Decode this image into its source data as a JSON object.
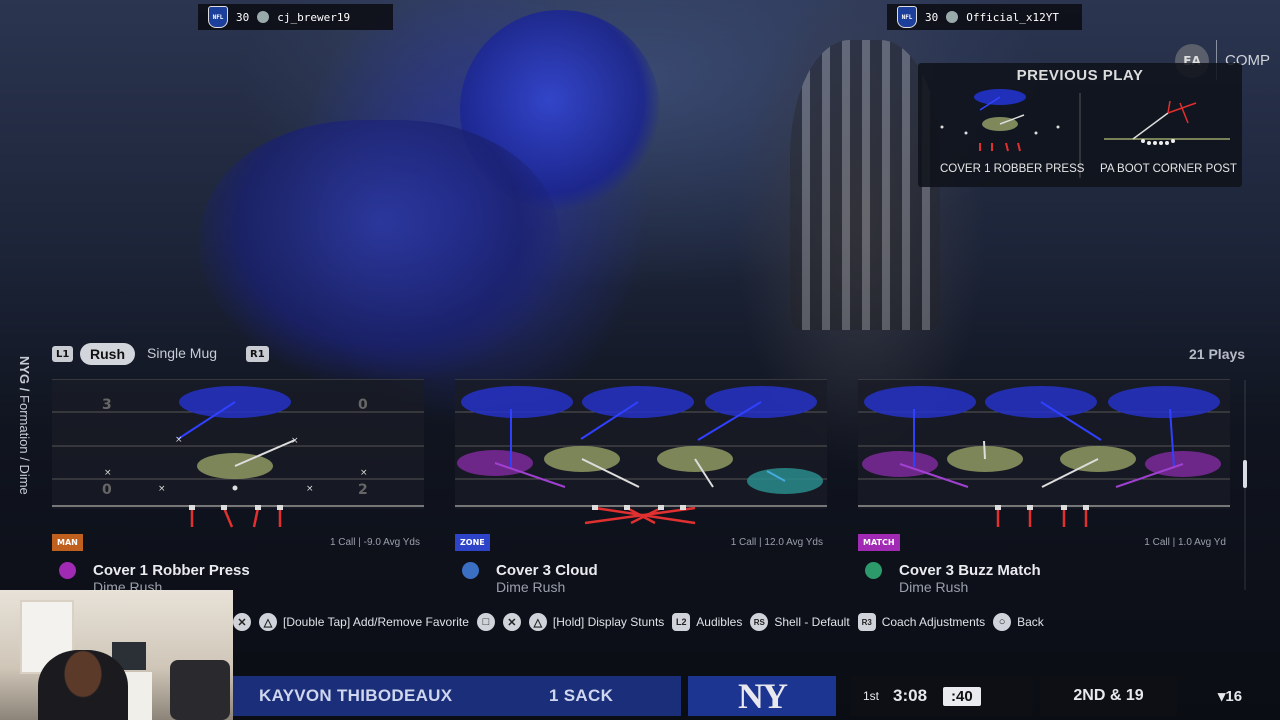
{
  "top_bar": {
    "left_player": {
      "badge": "NFL",
      "rating": "30",
      "name": "cj_brewer19"
    },
    "right_player": {
      "badge": "NFL",
      "rating": "30",
      "name": "Official_x12YT"
    }
  },
  "brand": {
    "logo_text": "EA",
    "mode": "COMP"
  },
  "previous_play": {
    "title": "PREVIOUS PLAY",
    "defense": "COVER 1 ROBBER PRESS",
    "offense": "PA BOOT CORNER POST"
  },
  "breadcrumb": {
    "team": "NYG",
    "sep": "/",
    "formation": "Formation",
    "sep2": "/",
    "set": "Dime"
  },
  "tabs": {
    "left_button": "L1",
    "right_button": "R1",
    "active": "Rush",
    "other": "Single Mug"
  },
  "play_count": "21 Plays",
  "plays": [
    {
      "tag": "MAN",
      "tag_color": "#d2691e",
      "stat": "1 Call | -9.0 Avg Yds",
      "name": "Cover 1 Robber Press",
      "sub": "Dime Rush",
      "button_icon": "square-icon"
    },
    {
      "tag": "ZONE",
      "tag_color": "#2d44c8",
      "stat": "1 Call | 12.0 Avg Yds",
      "name": "Cover 3 Cloud",
      "sub": "Dime Rush",
      "button_icon": "cross-icon"
    },
    {
      "tag": "MATCH",
      "tag_color": "#a12ab5",
      "stat": "1 Call | 1.0 Avg Yd",
      "name": "Cover 3 Buzz Match",
      "sub": "Dime Rush",
      "button_icon": "triangle-icon"
    }
  ],
  "hints": {
    "fav": "[Double Tap] Add/Remove Favorite",
    "stunts": "[Hold] Display Stunts",
    "audibles": "Audibles",
    "audibles_btn": "L2",
    "shell": "Shell - Default",
    "shell_btn": "RS",
    "coach": "Coach Adjustments",
    "coach_btn": "R3",
    "back": "Back"
  },
  "banner": {
    "player": "KAYVON THIBODEAUX",
    "stat": "1 SACK",
    "team_logo": "NY"
  },
  "scoreboard": {
    "quarter": "1st",
    "clock": "3:08",
    "play_clock": ":40",
    "down": "2ND & 19",
    "spot": "▾16"
  }
}
